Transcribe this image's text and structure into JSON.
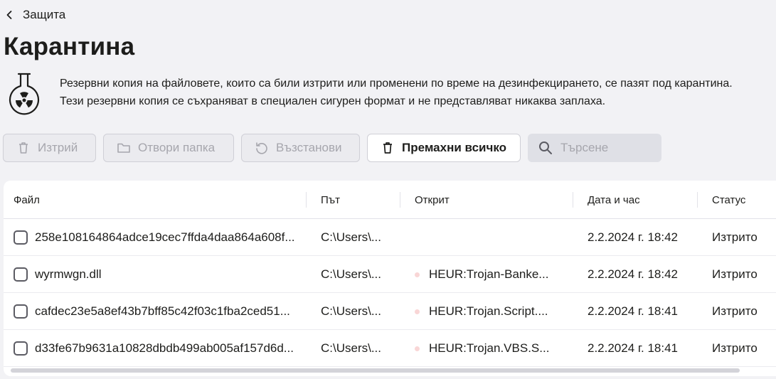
{
  "nav": {
    "back_label": "Защита"
  },
  "page": {
    "title": "Карантина",
    "description": "Резервни копия на файловете, които са били изтрити или променени по време на дезинфекцирането, се пазят под карантина. Тези резервни копия се съхраняват в специален сигурен формат и не представляват никаква заплаха."
  },
  "toolbar": {
    "delete_label": "Изтрий",
    "open_folder_label": "Отвори папка",
    "restore_label": "Възстанови",
    "remove_all_label": "Премахни всичко",
    "search_placeholder": "Търсене",
    "search_value": ""
  },
  "table": {
    "columns": {
      "file": "Файл",
      "path": "Път",
      "detected": "Открит",
      "datetime": "Дата и час",
      "status": "Статус"
    },
    "rows": [
      {
        "file": "258e108164864adce19cec7ffda4daa864a608f...",
        "path": "C:\\Users\\...",
        "detected": "",
        "datetime": "2.2.2024 г. 18:42",
        "status": "Изтрито"
      },
      {
        "file": "wyrmwgn.dll",
        "path": "C:\\Users\\...",
        "detected": "HEUR:Trojan-Banke...",
        "datetime": "2.2.2024 г. 18:42",
        "status": "Изтрито"
      },
      {
        "file": "cafdec23e5a8ef43b7bff85c42f03c1fba2ced51...",
        "path": "C:\\Users\\...",
        "detected": "HEUR:Trojan.Script....",
        "datetime": "2.2.2024 г. 18:41",
        "status": "Изтрито"
      },
      {
        "file": "d33fe67b9631a10828dbdb499ab005af157d6d...",
        "path": "C:\\Users\\...",
        "detected": "HEUR:Trojan.VBS.S...",
        "datetime": "2.2.2024 г. 18:41",
        "status": "Изтрито"
      }
    ]
  },
  "icons": {
    "back": "chevron-left-icon",
    "quarantine": "flask-radiation-icon",
    "delete": "trash-icon",
    "open_folder": "folder-icon",
    "restore": "restore-icon",
    "search": "search-icon"
  },
  "colors": {
    "background": "#f2f2f5",
    "disabled_text": "#a6a6ad",
    "threat_dot": "#f9d6d6"
  }
}
